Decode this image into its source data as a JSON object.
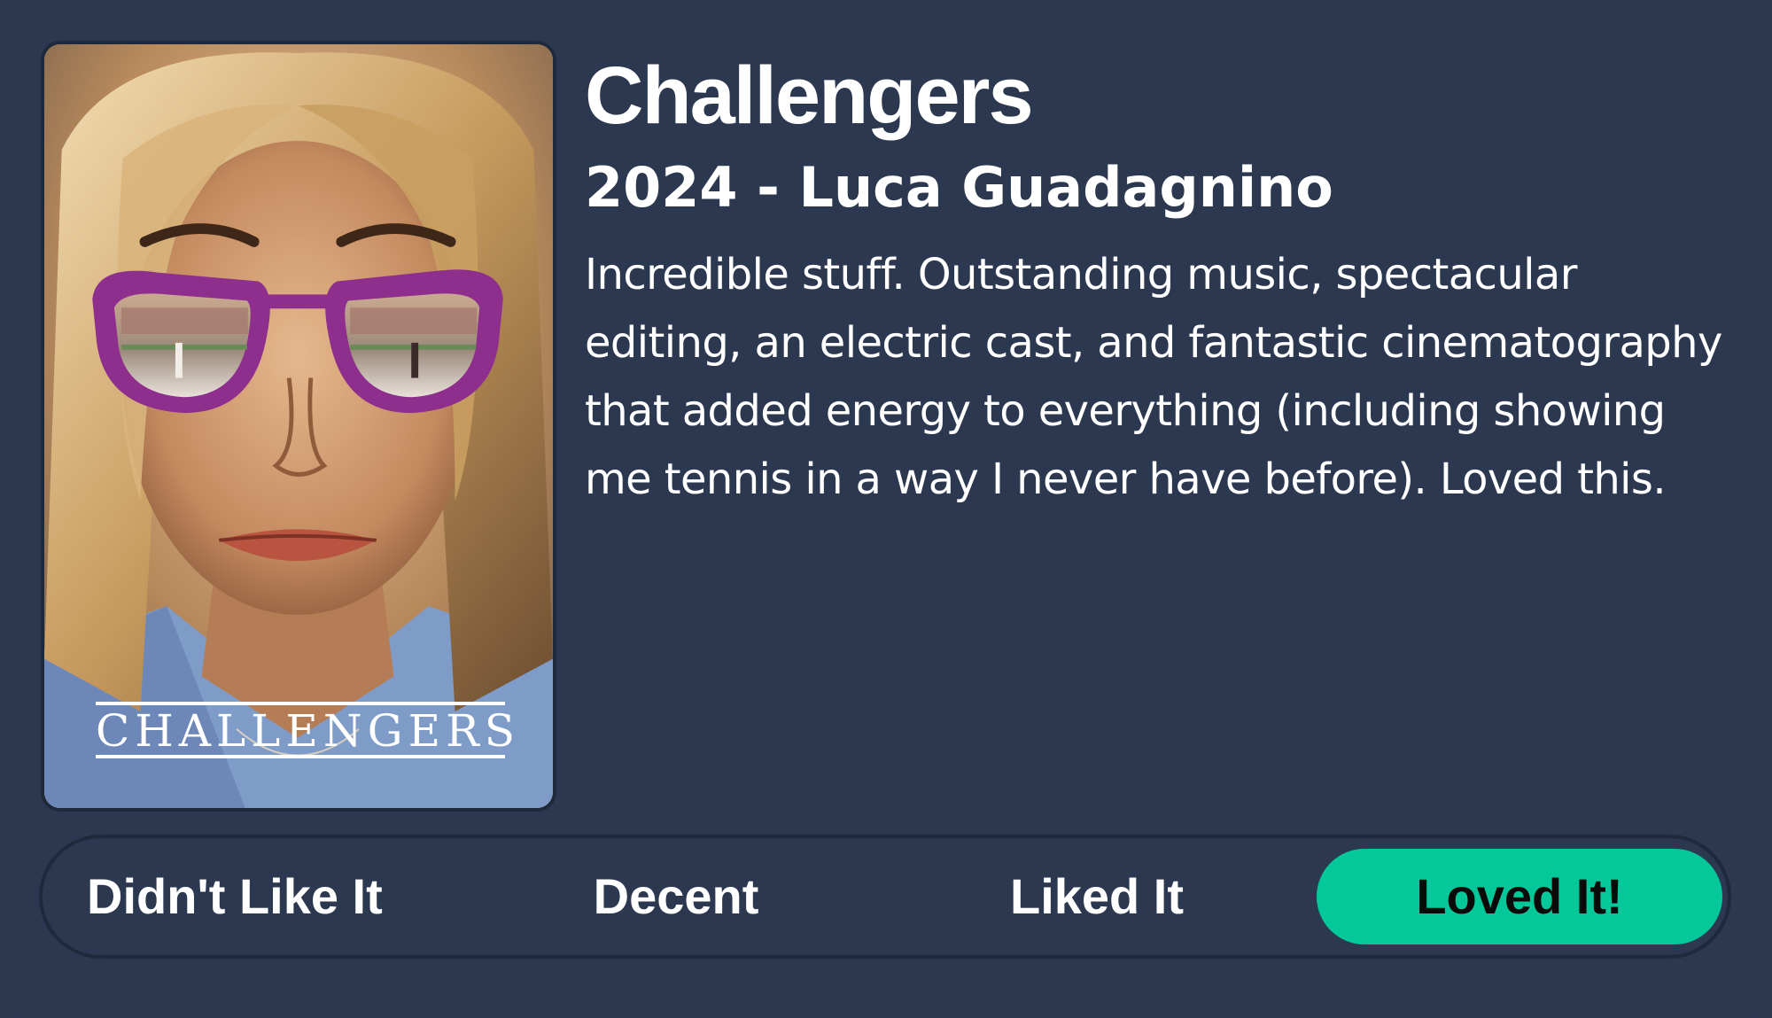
{
  "movie": {
    "title": "Challengers",
    "subtitle": "2024 - Luca Guadagnino",
    "review": "Incredible stuff. Outstanding music, spectacular editing, an electric cast, and fantastic cinematography that added energy to everything (including showing me tennis in a way I never have before). Loved this."
  },
  "poster": {
    "title_text": "CHALLENGERS"
  },
  "rating": {
    "options": [
      {
        "label": "Didn't Like It",
        "selected": false
      },
      {
        "label": "Decent",
        "selected": false
      },
      {
        "label": "Liked It",
        "selected": false
      },
      {
        "label": "Loved It!",
        "selected": true
      }
    ]
  },
  "colors": {
    "background": "#2c3850",
    "border": "#1f293c",
    "accent": "#05c89a",
    "text": "#ffffff"
  }
}
